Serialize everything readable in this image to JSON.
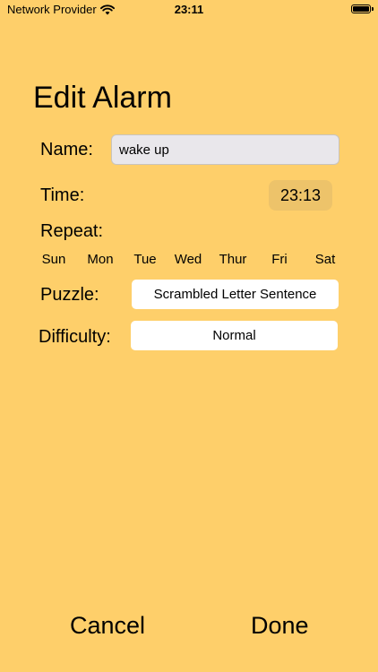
{
  "status_bar": {
    "carrier": "Network Provider",
    "time": "23:11"
  },
  "title": "Edit Alarm",
  "name": {
    "label": "Name:",
    "value": "wake up"
  },
  "time": {
    "label": "Time:",
    "value": "23:13"
  },
  "repeat": {
    "label": "Repeat:",
    "days": [
      "Sun",
      "Mon",
      "Tue",
      "Wed",
      "Thur",
      "Fri",
      "Sat"
    ]
  },
  "puzzle": {
    "label": "Puzzle:",
    "value": "Scrambled Letter Sentence"
  },
  "difficulty": {
    "label": "Difficulty:",
    "value": "Normal"
  },
  "buttons": {
    "cancel": "Cancel",
    "done": "Done"
  },
  "colors": {
    "background": "#FECF6A",
    "time_pill": "#EDC36A",
    "name_field": "#E9E7EB"
  }
}
